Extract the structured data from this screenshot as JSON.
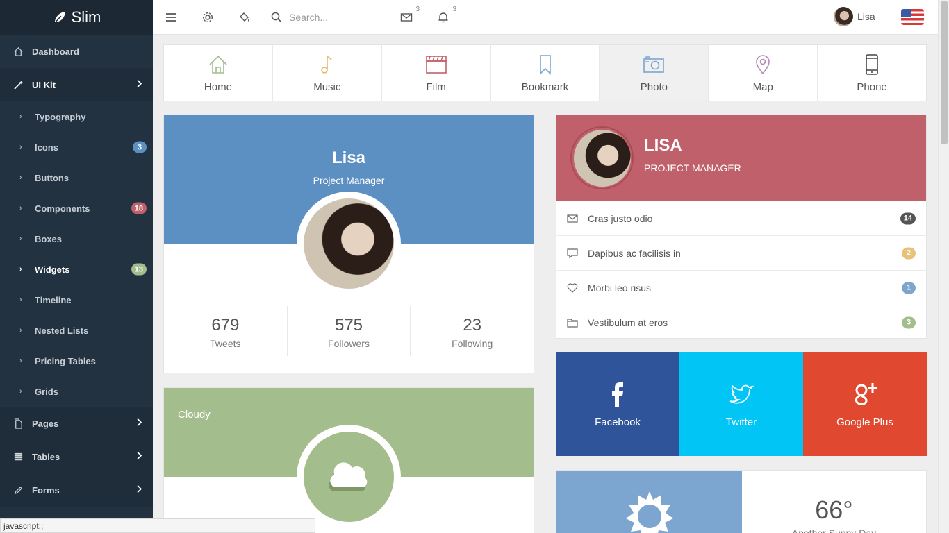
{
  "brand": {
    "name": "Slim"
  },
  "sidebar": {
    "items": [
      {
        "label": "Dashboard"
      },
      {
        "label": "UI Kit"
      },
      {
        "label": "Pages"
      },
      {
        "label": "Tables"
      },
      {
        "label": "Forms"
      }
    ],
    "submenu": [
      {
        "label": "Typography",
        "badge": ""
      },
      {
        "label": "Icons",
        "badge": "3"
      },
      {
        "label": "Buttons",
        "badge": ""
      },
      {
        "label": "Components",
        "badge": "18"
      },
      {
        "label": "Boxes",
        "badge": ""
      },
      {
        "label": "Widgets",
        "badge": "13"
      },
      {
        "label": "Timeline",
        "badge": ""
      },
      {
        "label": "Nested Lists",
        "badge": ""
      },
      {
        "label": "Pricing Tables",
        "badge": ""
      },
      {
        "label": "Grids",
        "badge": ""
      }
    ]
  },
  "topbar": {
    "search_placeholder": "Search...",
    "mail_count": "3",
    "notif_count": "3",
    "user_name": "Lisa"
  },
  "tabs": [
    {
      "label": "Home"
    },
    {
      "label": "Music"
    },
    {
      "label": "Film"
    },
    {
      "label": "Bookmark"
    },
    {
      "label": "Photo"
    },
    {
      "label": "Map"
    },
    {
      "label": "Phone"
    }
  ],
  "profile1": {
    "name": "Lisa",
    "role": "Project Manager",
    "stats": [
      {
        "value": "679",
        "label": "Tweets"
      },
      {
        "value": "575",
        "label": "Followers"
      },
      {
        "value": "23",
        "label": "Following"
      }
    ]
  },
  "weather1": {
    "title": "Cloudy"
  },
  "profile2": {
    "name": "LISA",
    "role": "PROJECT MANAGER",
    "list": [
      {
        "label": "Cras justo odio",
        "badge": "14"
      },
      {
        "label": "Dapibus ac facilisis in",
        "badge": "2"
      },
      {
        "label": "Morbi leo risus",
        "badge": "1"
      },
      {
        "label": "Vestibulum at eros",
        "badge": "3"
      }
    ]
  },
  "social": [
    {
      "label": "Facebook"
    },
    {
      "label": "Twitter"
    },
    {
      "label": "Google Plus"
    }
  ],
  "weather2": {
    "temp": "66°",
    "desc": "Another Sunny Day"
  },
  "statusbar": {
    "text": "javascript:;"
  },
  "colors": {
    "sidebar": "#233241",
    "blue": "#5c8fc2",
    "green": "#a3bd8c",
    "red": "#c0606a",
    "facebook": "#30549a",
    "twitter": "#00c5f5",
    "googleplus": "#e0482f"
  }
}
